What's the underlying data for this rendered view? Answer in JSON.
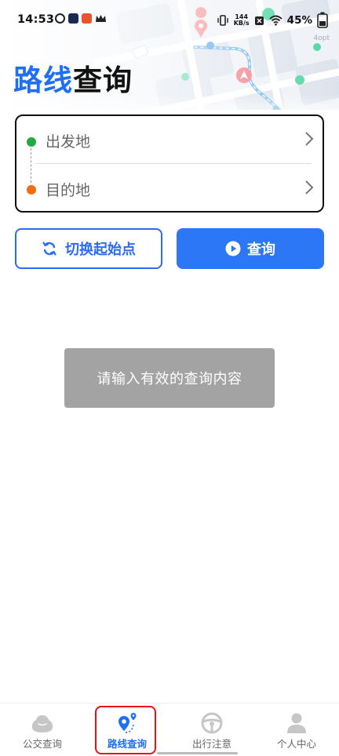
{
  "status_bar": {
    "time": "14:53",
    "net_speed_value": "144",
    "net_speed_unit": "KB/s",
    "battery_percent": "45%",
    "corner_tag": "4opt"
  },
  "title": {
    "part_accent": "路线",
    "part_dark": "查询"
  },
  "route_form": {
    "from_placeholder": "出发地",
    "to_placeholder": "目的地"
  },
  "actions": {
    "swap_label": "切换起始点",
    "query_label": "查询"
  },
  "toast": {
    "message": "请输入有效的查询内容"
  },
  "tabs": [
    {
      "label": "公交查询",
      "icon": "bus-query-icon",
      "active": false
    },
    {
      "label": "路线查询",
      "icon": "route-query-icon",
      "active": true
    },
    {
      "label": "出行注意",
      "icon": "steering-wheel-icon",
      "active": false
    },
    {
      "label": "个人中心",
      "icon": "person-icon",
      "active": false
    }
  ],
  "colors": {
    "accent": "#1f6ff2",
    "query_button": "#2b77f6",
    "start_dot": "#28a745",
    "end_dot": "#f06d10",
    "highlight": "#e11111"
  }
}
